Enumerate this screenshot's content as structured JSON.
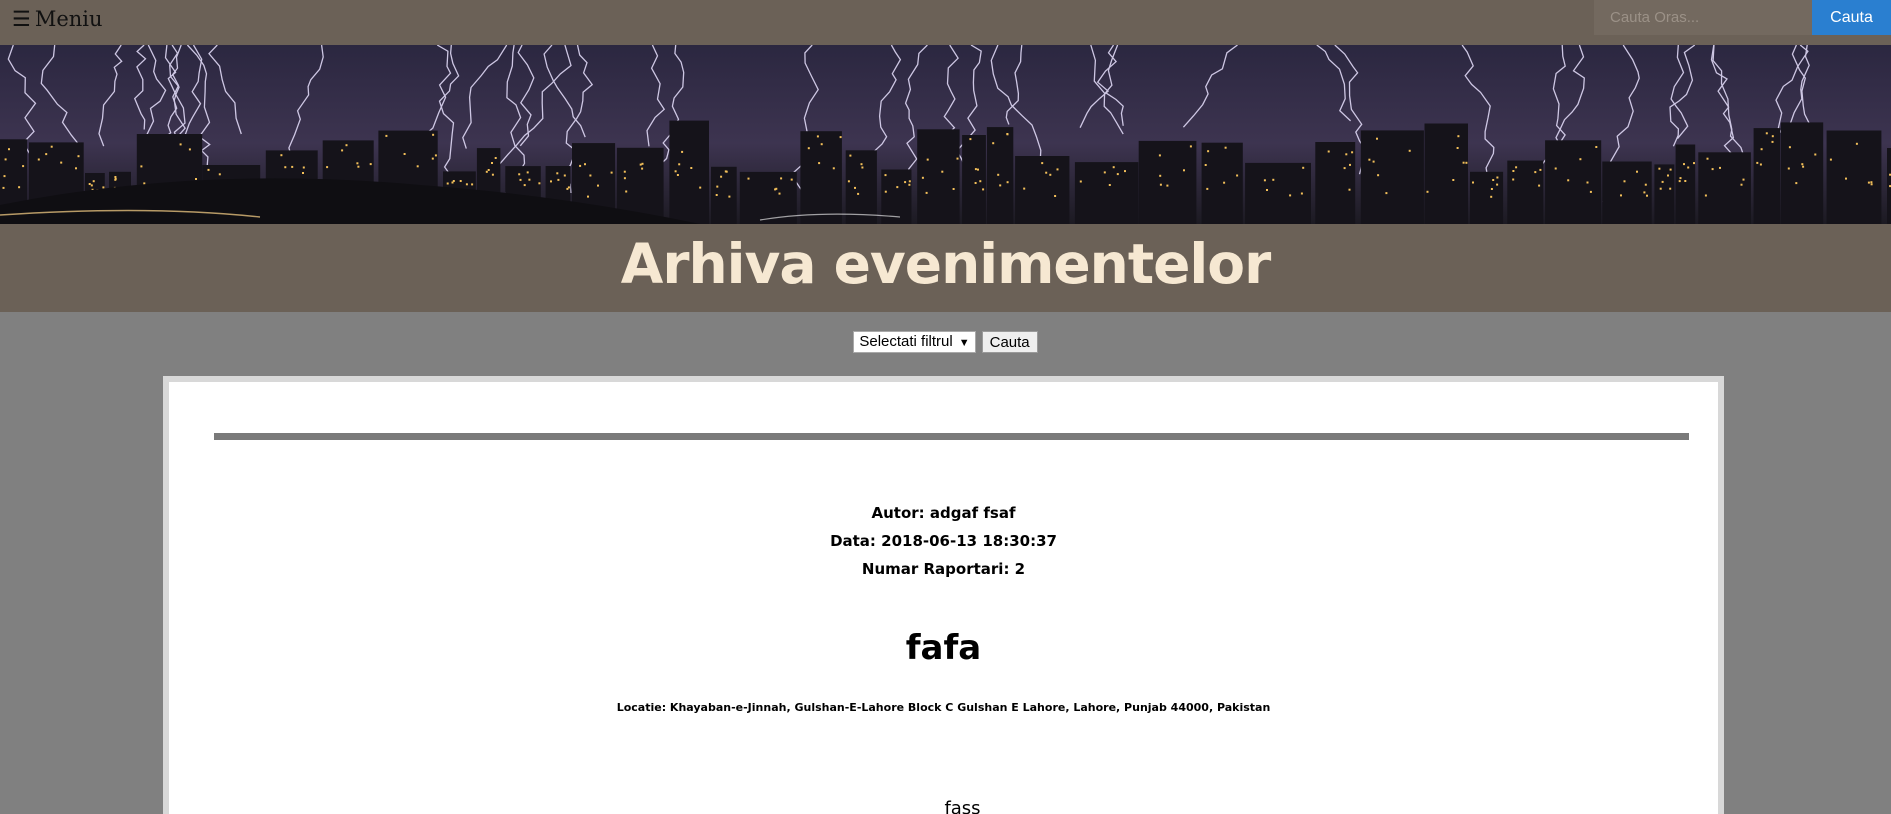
{
  "navbar": {
    "menu_icon": "hamburger-icon",
    "menu_label": "Meniu",
    "search_placeholder": "Cauta Oras...",
    "search_value": "",
    "search_button": "Cauta"
  },
  "banner": {
    "image": "lightning-storm-city-skyline"
  },
  "page": {
    "title": "Arhiva evenimentelor"
  },
  "filter": {
    "select_value": "Selectati filtrul",
    "button_label": "Cauta"
  },
  "event": {
    "author": "Autor: adgaf fsaf",
    "date": "Data: 2018-06-13 18:30:37",
    "reports": "Numar Raportari: 2",
    "title": "fafa",
    "location": "Locatie: Khayaban-e-Jinnah, Gulshan-E-Lahore Block C Gulshan E Lahore, Lahore, Punjab 44000, Pakistan",
    "description": "fass"
  },
  "colors": {
    "navbar_bg": "#6b6157",
    "page_bg": "#808080",
    "title_text": "#f6e8d2",
    "search_button_bg": "#2a7fd0"
  }
}
